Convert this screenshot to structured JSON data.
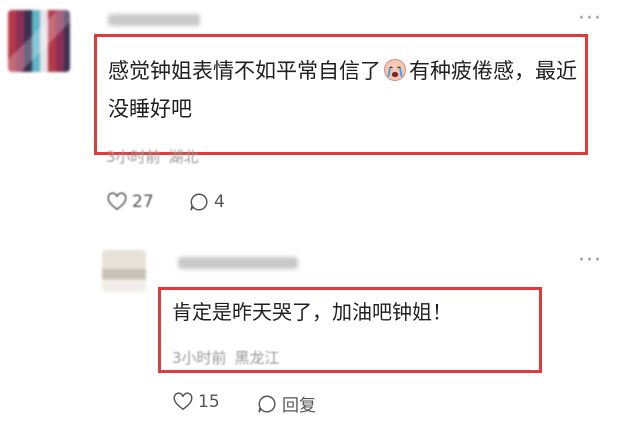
{
  "comments": [
    {
      "text_before": "感觉钟姐表情不如平常自信了",
      "text_after": "有种疲倦感，最近没睡好吧",
      "time": "3小时前",
      "location": "湖北",
      "likes": "27",
      "replies": "4",
      "emoji": "crying-face-icon"
    },
    {
      "text": "肯定是昨天哭了，加油吧钟姐！",
      "time": "3小时前",
      "location": "黑龙江",
      "likes": "15",
      "reply_label": "回复"
    }
  ],
  "icons": {
    "more": "more-options-icon",
    "like": "heart-icon",
    "reply": "comment-bubble-icon"
  },
  "colors": {
    "highlight": "#e03a3a",
    "meta_text": "#9a9a9a"
  }
}
